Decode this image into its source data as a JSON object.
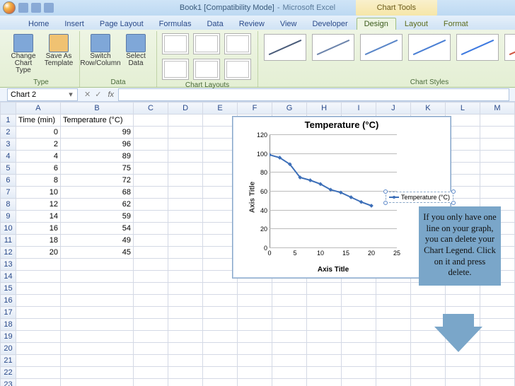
{
  "window": {
    "doc_title": "Book1  [Compatibility Mode]",
    "app_title": "Microsoft Excel",
    "charttools_label": "Chart Tools"
  },
  "tabs": {
    "items": [
      "Home",
      "Insert",
      "Page Layout",
      "Formulas",
      "Data",
      "Review",
      "View",
      "Developer"
    ],
    "contextual": [
      "Design",
      "Layout",
      "Format"
    ],
    "active": "Design"
  },
  "ribbon": {
    "type": {
      "label": "Type",
      "change_chart_type": "Change Chart Type",
      "save_as_template": "Save As Template"
    },
    "data": {
      "label": "Data",
      "switch": "Switch Row/Column",
      "select": "Select Data"
    },
    "layouts": {
      "label": "Chart Layouts"
    },
    "styles": {
      "label": "Chart Styles",
      "colors": [
        "#495b79",
        "#6d85ac",
        "#5a86c8",
        "#4a7fd4",
        "#3d79e0",
        "#d0543f",
        "#a6c84a"
      ]
    }
  },
  "namebox": {
    "value": "Chart 2",
    "fx": "fx"
  },
  "columns": [
    "A",
    "B",
    "C",
    "D",
    "E",
    "F",
    "G",
    "H",
    "I",
    "J",
    "K",
    "L",
    "M"
  ],
  "headers": {
    "A": "Time (min)",
    "B": "Temperature (°C)"
  },
  "rows": [
    {
      "t": 0,
      "v": 99
    },
    {
      "t": 2,
      "v": 96
    },
    {
      "t": 4,
      "v": 89
    },
    {
      "t": 6,
      "v": 75
    },
    {
      "t": 8,
      "v": 72
    },
    {
      "t": 10,
      "v": 68
    },
    {
      "t": 12,
      "v": 62
    },
    {
      "t": 14,
      "v": 59
    },
    {
      "t": 16,
      "v": 54
    },
    {
      "t": 18,
      "v": 49
    },
    {
      "t": 20,
      "v": 45
    }
  ],
  "total_rows": 23,
  "chart_data": {
    "type": "line",
    "title": "Temperature (°C)",
    "xlabel": "Axis Title",
    "ylabel": "Axis Title",
    "x": [
      0,
      2,
      4,
      6,
      8,
      10,
      12,
      14,
      16,
      18,
      20
    ],
    "series": [
      {
        "name": "Temperature (°C)",
        "values": [
          99,
          96,
          89,
          75,
          72,
          68,
          62,
          59,
          54,
          49,
          45
        ]
      }
    ],
    "xlim": [
      0,
      25
    ],
    "xticks": [
      0,
      5,
      10,
      15,
      20,
      25
    ],
    "ylim": [
      0,
      120
    ],
    "yticks": [
      0,
      20,
      40,
      60,
      80,
      100,
      120
    ],
    "legend_position": "right",
    "grid": "horizontal"
  },
  "callout": {
    "text": "If you only have one line on your graph, you can delete your Chart Legend. Click on it and press delete."
  }
}
